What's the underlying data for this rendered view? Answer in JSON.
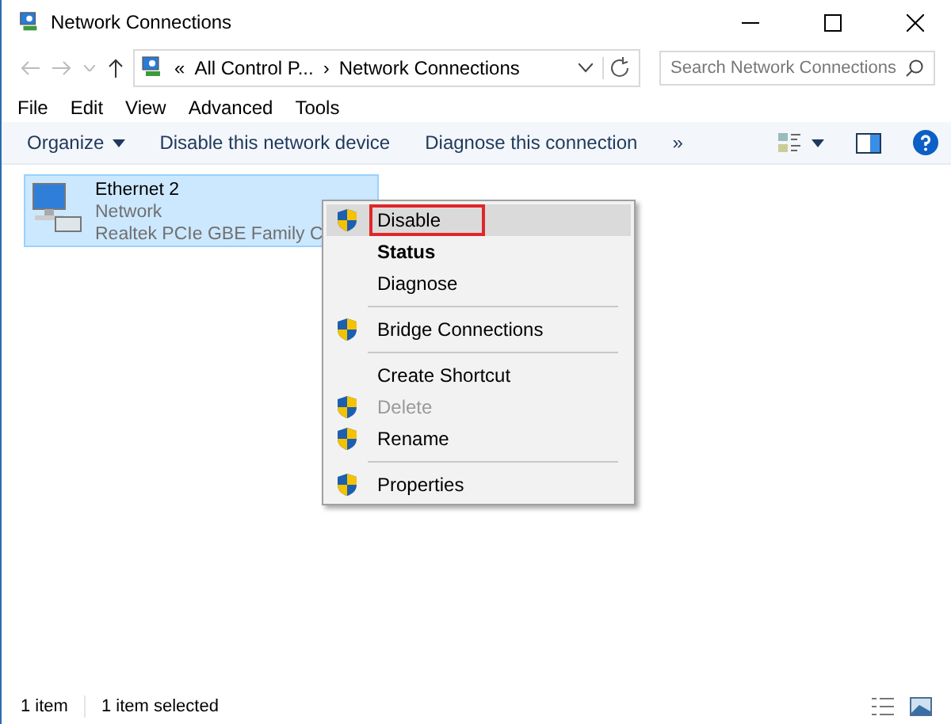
{
  "window": {
    "title": "Network Connections"
  },
  "address": {
    "overflow": "«",
    "separator": "›",
    "crumbs": [
      "All Control P...",
      "Network Connections"
    ]
  },
  "search": {
    "placeholder": "Search Network Connections"
  },
  "menu_bar": [
    "File",
    "Edit",
    "View",
    "Advanced",
    "Tools"
  ],
  "toolbar": {
    "organize": "Organize",
    "commands": [
      "Disable this network device",
      "Diagnose this connection"
    ],
    "more": "»"
  },
  "items": [
    {
      "name": "Ethernet 2",
      "network": "Network",
      "adapter": "Realtek PCIe GBE Family C",
      "selected": true
    }
  ],
  "context_menu": [
    {
      "kind": "item",
      "label": "Disable",
      "shield": true,
      "bold": false,
      "disabled": false,
      "highlighted": true
    },
    {
      "kind": "item",
      "label": "Status",
      "shield": false,
      "bold": true,
      "disabled": false,
      "highlighted": false
    },
    {
      "kind": "item",
      "label": "Diagnose",
      "shield": false,
      "bold": false,
      "disabled": false,
      "highlighted": false
    },
    {
      "kind": "separator"
    },
    {
      "kind": "item",
      "label": "Bridge Connections",
      "shield": true,
      "bold": false,
      "disabled": false,
      "highlighted": false
    },
    {
      "kind": "separator"
    },
    {
      "kind": "item",
      "label": "Create Shortcut",
      "shield": false,
      "bold": false,
      "disabled": false,
      "highlighted": false
    },
    {
      "kind": "item",
      "label": "Delete",
      "shield": true,
      "bold": false,
      "disabled": true,
      "highlighted": false
    },
    {
      "kind": "item",
      "label": "Rename",
      "shield": true,
      "bold": false,
      "disabled": false,
      "highlighted": false
    },
    {
      "kind": "separator"
    },
    {
      "kind": "item",
      "label": "Properties",
      "shield": true,
      "bold": false,
      "disabled": false,
      "highlighted": false
    }
  ],
  "status_bar": [
    "1 item",
    "1 item selected"
  ]
}
